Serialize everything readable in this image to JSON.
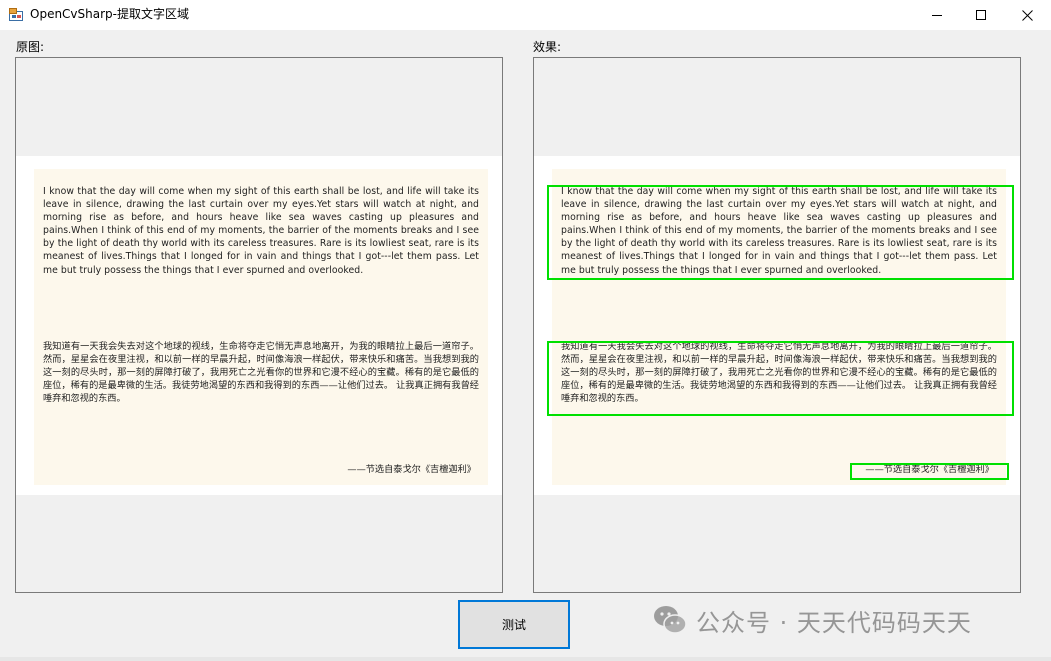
{
  "window": {
    "title": "OpenCvSharp-提取文字区域"
  },
  "labels": {
    "original": "原图:",
    "effect": "效果:"
  },
  "image": {
    "english_paragraph": "I know that the day will come when my sight of this earth shall be lost, and life will take its leave in silence, drawing the last curtain over my eyes.Yet stars will watch at night, and morning rise as before, and hours heave like sea waves casting up pleasures and pains.When I think of this end of my moments, the barrier of the moments breaks and I see by the light of death thy world with its careless treasures. Rare is its lowliest seat, rare is its meanest of lives.Things that I longed for in vain and things that I got---let them pass. Let me but truly possess the things that I ever spurned and overlooked.",
    "chinese_paragraph": "我知道有一天我会失去对这个地球的视线，生命将夺走它悄无声息地离开，为我的眼睛拉上最后一道帘子。然而，星星会在夜里注视，和以前一样的早晨升起，时间像海浪一样起伏，带来快乐和痛苦。当我想到我的这一刻的尽头时，那一刻的屏障打破了，我用死亡之光看你的世界和它漫不经心的宝藏。稀有的是它最低的座位，稀有的是最卑微的生活。我徒劳地渴望的东西和我得到的东西——让他们过去。 让我真正拥有我曾经唾弃和忽视的东西。",
    "signature": "——节选自泰戈尔《吉檀迦利》"
  },
  "buttons": {
    "test": "测试"
  },
  "watermark": {
    "text": "公众号 · 天天代码码天天"
  },
  "colors": {
    "detection_box": "#00e000",
    "button_border": "#0078d7",
    "paper": "#fdf8ec"
  }
}
